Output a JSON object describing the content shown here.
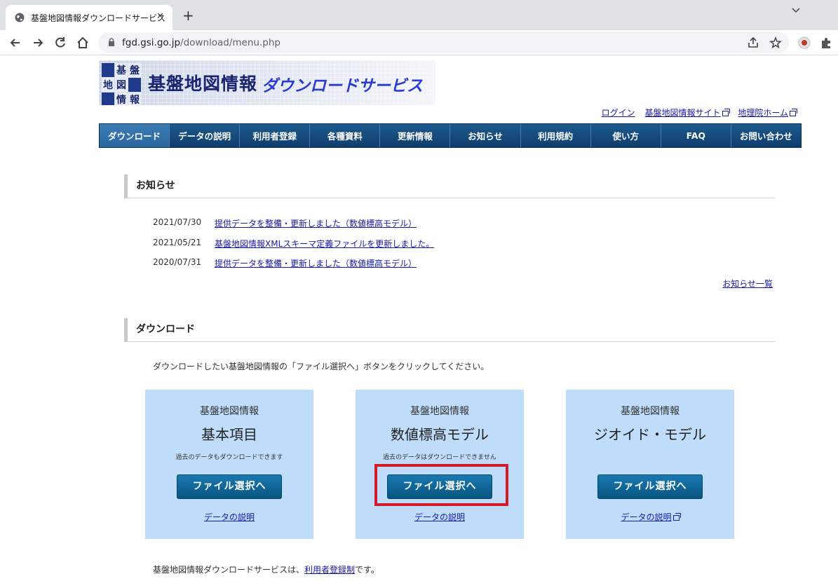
{
  "browser": {
    "tab_title": "基盤地図情報ダウンロードサービス",
    "tab_close": "✕",
    "new_tab": "+",
    "url_host": "fgd.gsi.go.jp",
    "url_path": "/download/menu.php"
  },
  "banner": {
    "logo_chars": [
      "基",
      "盤",
      "地",
      "図",
      "情",
      "報"
    ],
    "title": "基盤地図情報",
    "subtitle": "ダウンロードサービス"
  },
  "toplinks": {
    "login": "ログイン",
    "site": "基盤地図情報サイト",
    "home": "地理院ホーム"
  },
  "nav": {
    "items": [
      "ダウンロード",
      "データの説明",
      "利用者登録",
      "各種資料",
      "更新情報",
      "お知らせ",
      "利用規約",
      "使い方",
      "FAQ",
      "お問い合わせ"
    ]
  },
  "news": {
    "heading": "お知らせ",
    "rows": [
      {
        "date": "2021/07/30",
        "text": "提供データを整備・更新しました（数値標高モデル）"
      },
      {
        "date": "2021/05/21",
        "text": "基盤地図情報XMLスキーマ定義ファイルを更新しました。"
      },
      {
        "date": "2020/07/31",
        "text": "提供データを整備・更新しました（数値標高モデル）"
      }
    ],
    "more": "お知らせ一覧"
  },
  "download": {
    "heading": "ダウンロード",
    "intro": "ダウンロードしたい基盤地図情報の「ファイル選択へ」ボタンをクリックしてください。",
    "cards": [
      {
        "sub": "基盤地図情報",
        "title": "基本項目",
        "note": "過去のデータもダウンロードできます",
        "button": "ファイル選択へ",
        "link": "データの説明"
      },
      {
        "sub": "基盤地図情報",
        "title": "数値標高モデル",
        "note": "過去のデータはダウンロードできません",
        "button": "ファイル選択へ",
        "link": "データの説明"
      },
      {
        "sub": "基盤地図情報",
        "title": "ジオイド・モデル",
        "note": "",
        "button": "ファイル選択へ",
        "link": "データの説明"
      }
    ],
    "footnote_pre": "基盤地図情報ダウンロードサービスは、",
    "footnote_link": "利用者登録制",
    "footnote_post": "です。"
  },
  "colors": {
    "nav_bg": "#0f3d6c",
    "card_bg": "#bfdcfa",
    "button_bg": "#08557f",
    "highlight": "#d21c2a",
    "link": "#1a1aa6"
  }
}
